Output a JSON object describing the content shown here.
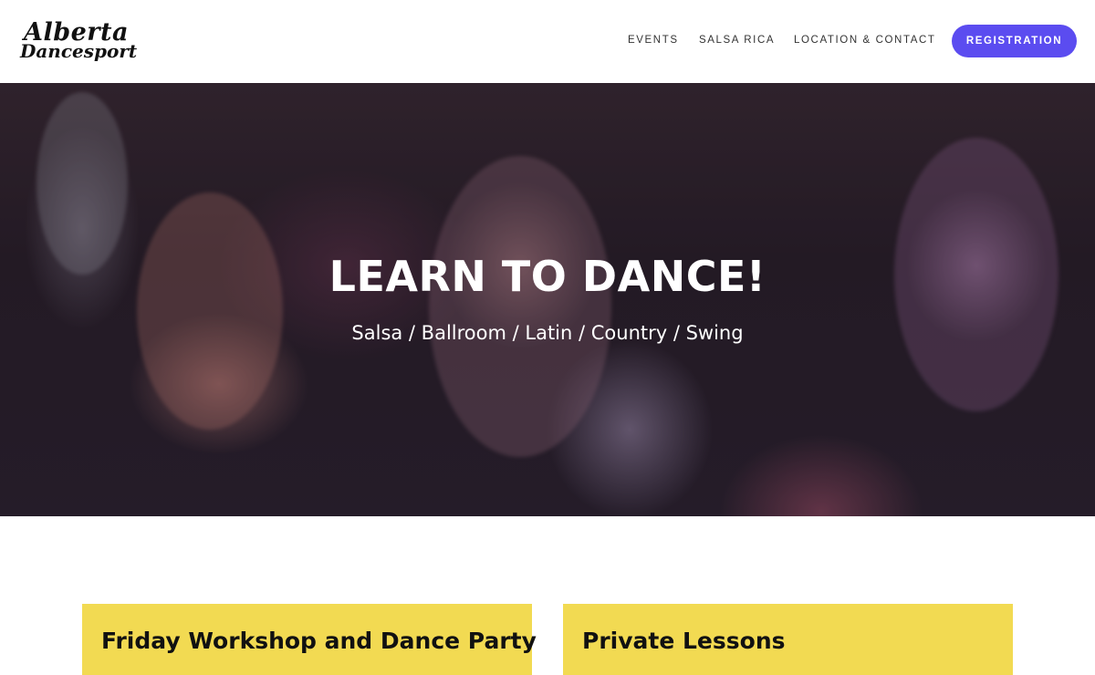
{
  "logo": {
    "line1": "Alberta",
    "line2": "Dancesport"
  },
  "nav": {
    "events": "EVENTS",
    "salsa": "SALSA RICA",
    "location": "LOCATION & CONTACT",
    "registration": "REGISTRATION"
  },
  "hero": {
    "title": "LEARN TO DANCE!",
    "subtitle": "Salsa / Ballroom / Latin / Country / Swing"
  },
  "cards": [
    {
      "title": "Friday Workshop and Dance Party"
    },
    {
      "title": "Private Lessons"
    }
  ],
  "colors": {
    "accent": "#5b4cf0",
    "card": "#f2da52",
    "hero_text": "#ffffff"
  }
}
